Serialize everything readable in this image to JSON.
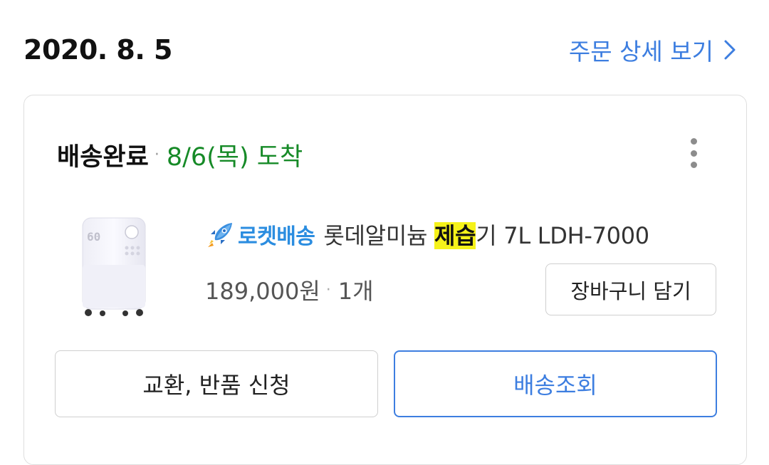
{
  "order": {
    "date": "2020. 8. 5",
    "detail_link": "주문 상세 보기"
  },
  "shipment": {
    "status": "배송완료",
    "separator": "·",
    "arrival": "8/6(목) 도착"
  },
  "product": {
    "badge_label": "로켓배송",
    "name_before": "롯데알미늄 ",
    "name_highlight": "제습",
    "name_after": "기 7L LDH-7000",
    "image_display_text": "60",
    "price": "189,000원",
    "separator": "·",
    "quantity": "1개"
  },
  "actions": {
    "cart": "장바구니 담기",
    "exchange_return": "교환, 반품 신청",
    "tracking": "배송조회"
  },
  "colors": {
    "link_blue": "#3d7ee0",
    "arrival_green": "#168a27",
    "rocket_blue": "#2b8de0",
    "highlight_yellow": "#f5f21a"
  },
  "icons": {
    "detail_chevron": "chevron-right-icon",
    "more": "more-vertical-icon",
    "rocket": "rocket-icon"
  }
}
